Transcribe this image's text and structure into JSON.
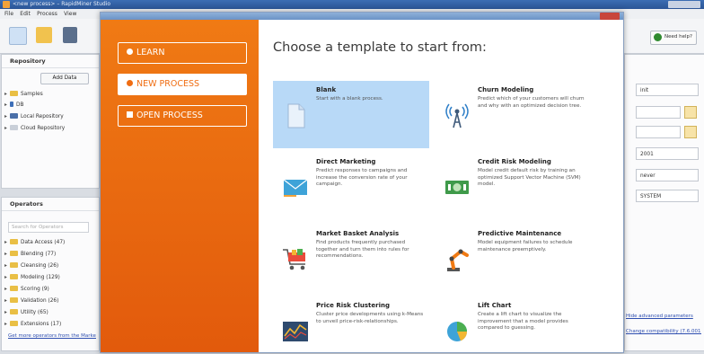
{
  "app": {
    "title": "<new process> – RapidMiner Studio",
    "menu": [
      "File",
      "Edit",
      "Process",
      "View"
    ],
    "help_label": "Need help?"
  },
  "repository": {
    "title": "Repository",
    "add_data": "Add Data",
    "items": [
      "Samples",
      "DB",
      "Local Repository",
      "Cloud Repository"
    ]
  },
  "operators": {
    "title": "Operators",
    "search_placeholder": "Search for Operators",
    "items": [
      "Data Access (47)",
      "Blending (77)",
      "Cleansing (26)",
      "Modeling (129)",
      "Scoring (9)",
      "Validation (26)",
      "Utility (65)",
      "Extensions (17)"
    ],
    "more_link": "Get more operators from the Marketplace"
  },
  "parameters": {
    "fields": [
      "init",
      "",
      "",
      "2001",
      "never",
      "SYSTEM"
    ],
    "link1": "Hide advanced parameters",
    "link2": "Change compatibility (7.6.001)"
  },
  "dialog": {
    "heading": "Choose a template to start from:",
    "nav": [
      {
        "label": "LEARN",
        "active": false
      },
      {
        "label": "NEW PROCESS",
        "active": true
      },
      {
        "label": "OPEN PROCESS",
        "active": false
      }
    ],
    "templates": [
      {
        "name": "Blank",
        "desc": "Start with a blank process.",
        "icon": "blank-page-icon"
      },
      {
        "name": "Churn Modeling",
        "desc": "Predict which of your customers will churn and why with an optimized decision tree.",
        "icon": "radio-tower-icon"
      },
      {
        "name": "Direct Marketing",
        "desc": "Predict responses to campaigns and increase the conversion rate of your campaign.",
        "icon": "envelope-icon"
      },
      {
        "name": "Credit Risk Modeling",
        "desc": "Model credit default risk by training an optimized Support Vector Machine (SVM) model.",
        "icon": "money-icon"
      },
      {
        "name": "Market Basket Analysis",
        "desc": "Find products frequently purchased together and turn them into rules for recommendations.",
        "icon": "shopping-cart-icon"
      },
      {
        "name": "Predictive Maintenance",
        "desc": "Model equipment failures to schedule maintenance preemptively.",
        "icon": "robot-arm-icon"
      },
      {
        "name": "Price Risk Clustering",
        "desc": "Cluster price developments using k-Means to unveil price-risk-relationships.",
        "icon": "price-chart-icon"
      },
      {
        "name": "Lift Chart",
        "desc": "Create a lift chart to visualize the improvement that a model provides compared to guessing.",
        "icon": "pie-chart-icon"
      }
    ]
  },
  "colors": {
    "accent": "#f06d12",
    "selected_tile": "#b8d9f7"
  }
}
